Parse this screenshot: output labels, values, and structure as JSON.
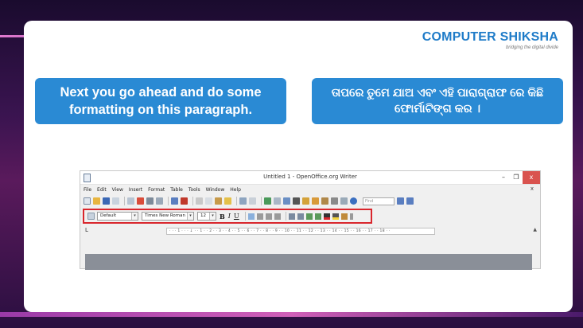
{
  "logo": {
    "name": "COMPUTER SHIKSHA",
    "tagline": "bridging the digital divide"
  },
  "callouts": {
    "english": "Next you go ahead and do some formatting on this paragraph.",
    "odia": "ତାପରେ ତୁମେ ଯାଅ ଏବଂ ଏହି ପାରାଗ୍ରାଫ ରେ କିଛି ଫୋର୍ମାଟିଙ୍ଗ କର ।"
  },
  "window": {
    "title": "Untitled 1 - OpenOffice.org Writer",
    "controls": [
      "–",
      "❐",
      "x"
    ],
    "doc_close": "x"
  },
  "menubar": [
    "File",
    "Edit",
    "View",
    "Insert",
    "Format",
    "Table",
    "Tools",
    "Window",
    "Help"
  ],
  "standard_toolbar": {
    "find_placeholder": "Find"
  },
  "formatting_toolbar": {
    "style": "Default",
    "font": "Times New Roman",
    "size": "12",
    "bold": "B",
    "italic": "I",
    "underline": "U",
    "highlight_color": "#d9262c"
  },
  "ruler": {
    "ticks": "· · · 1 · · · ↓ · · 1 · · 2 · · 3 · · 4 · · 5 · · 6 · · 7 · · 8 · · 9 · · 10 · · 11 · · 12 · · 13 · · 14 · · 15 · · 16 · · 17 · · 18 · ·"
  },
  "colors": {
    "callout": "#2a8ad4",
    "logo": "#1e7bc8"
  }
}
